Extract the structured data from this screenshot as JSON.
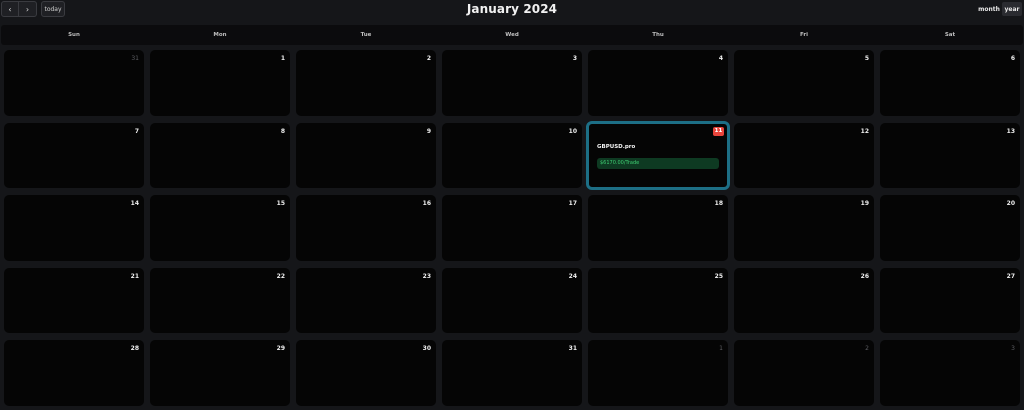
{
  "toolbar": {
    "prev_label": "‹",
    "next_label": "›",
    "today_label": "today",
    "title": "January 2024",
    "month_label": "month",
    "year_label": "year"
  },
  "weekdays": [
    "Sun",
    "Mon",
    "Tue",
    "Wed",
    "Thu",
    "Fri",
    "Sat"
  ],
  "weeks": [
    [
      {
        "day": "31",
        "other": true
      },
      {
        "day": "1"
      },
      {
        "day": "2"
      },
      {
        "day": "3"
      },
      {
        "day": "4"
      },
      {
        "day": "5"
      },
      {
        "day": "6"
      }
    ],
    [
      {
        "day": "7"
      },
      {
        "day": "8"
      },
      {
        "day": "9"
      },
      {
        "day": "10"
      },
      {
        "day": "11",
        "today": true
      },
      {
        "day": "12"
      },
      {
        "day": "13"
      }
    ],
    [
      {
        "day": "14"
      },
      {
        "day": "15"
      },
      {
        "day": "16"
      },
      {
        "day": "17"
      },
      {
        "day": "18"
      },
      {
        "day": "19"
      },
      {
        "day": "20"
      }
    ],
    [
      {
        "day": "21"
      },
      {
        "day": "22"
      },
      {
        "day": "23"
      },
      {
        "day": "24"
      },
      {
        "day": "25"
      },
      {
        "day": "26"
      },
      {
        "day": "27"
      }
    ],
    [
      {
        "day": "28"
      },
      {
        "day": "29"
      },
      {
        "day": "30"
      },
      {
        "day": "31"
      },
      {
        "day": "1",
        "other": true
      },
      {
        "day": "2",
        "other": true
      },
      {
        "day": "3",
        "other": true
      }
    ]
  ],
  "event": {
    "day": "11",
    "symbol": "GBPUSD.pro",
    "pnl": "$6170.00/Trade"
  },
  "colors": {
    "today_border": "#1d6f86",
    "today_badge": "#e8453c",
    "profit_bg": "#0e3a22",
    "profit_text": "#3ecf72"
  }
}
